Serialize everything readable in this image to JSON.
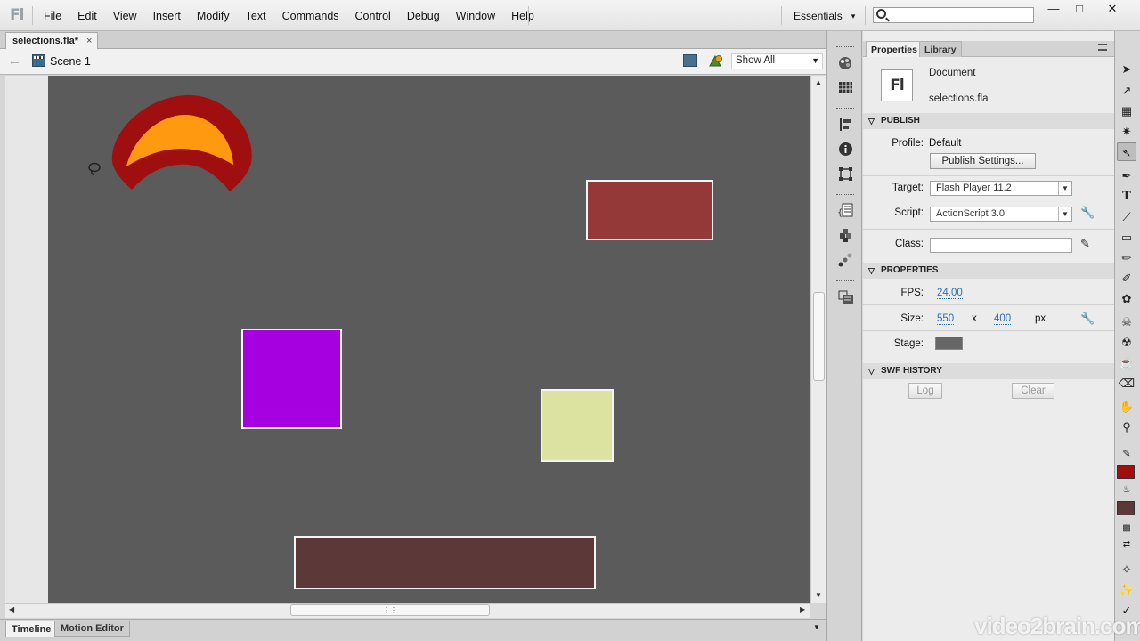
{
  "app": {
    "logo": "Fl"
  },
  "menu": [
    "File",
    "Edit",
    "View",
    "Insert",
    "Modify",
    "Text",
    "Commands",
    "Control",
    "Debug",
    "Window",
    "Help"
  ],
  "workspace": {
    "label": "Essentials"
  },
  "search": {
    "value": "",
    "placeholder": ""
  },
  "window_controls": {
    "minimize": "—",
    "maximize": "□",
    "close": "✕"
  },
  "document_tab": {
    "label": "selections.fla*",
    "close": "×"
  },
  "editbar": {
    "scene": "Scene 1",
    "zoom": "Show All"
  },
  "stage": {
    "background": "#5b5b5b",
    "shapes": [
      {
        "name": "rust-rectangle",
        "color": "#943838"
      },
      {
        "name": "purple-square",
        "color": "#a600e0"
      },
      {
        "name": "pale-yellow-square",
        "color": "#dce3a1"
      },
      {
        "name": "dark-brown-rectangle",
        "color": "#5c3838"
      }
    ],
    "arc": {
      "outer": "#a00f0f",
      "inner": "#ff9a10"
    }
  },
  "bottom_tabs": {
    "timeline": "Timeline",
    "motion_editor": "Motion Editor"
  },
  "properties": {
    "tabs": {
      "properties": "Properties",
      "library": "Library"
    },
    "doc_icon": "Fl",
    "doc_type": "Document",
    "doc_name": "selections.fla",
    "publish": {
      "heading": "PUBLISH",
      "profile_label": "Profile:",
      "profile_value": "Default",
      "settings_button": "Publish Settings...",
      "target_label": "Target:",
      "target_value": "Flash Player 11.2",
      "script_label": "Script:",
      "script_value": "ActionScript 3.0",
      "class_label": "Class:",
      "class_value": ""
    },
    "props": {
      "heading": "PROPERTIES",
      "fps_label": "FPS:",
      "fps_value": "24.00",
      "size_label": "Size:",
      "width": "550",
      "x": "x",
      "height": "400",
      "unit": "px",
      "stage_label": "Stage:",
      "stage_color": "#666666"
    },
    "swf_history": {
      "heading": "SWF HISTORY",
      "log": "Log",
      "clear": "Clear"
    }
  },
  "tools": {
    "stroke_color": "#a00f0f",
    "fill_color": "#5c3838"
  },
  "watermark": "video2brain.com"
}
